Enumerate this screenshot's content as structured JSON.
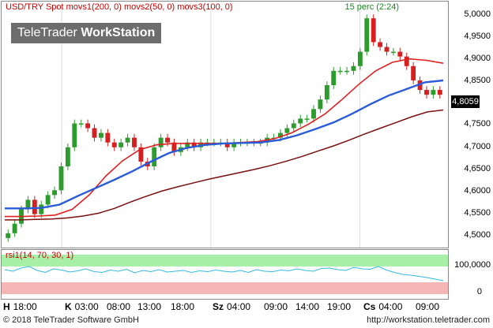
{
  "window": {
    "symbol": "USD/TRY Spot",
    "ma1": "movs1(200, 0)",
    "ma2": "movs2(50, 0)",
    "ma3": "movs3(100, 0)",
    "interval": "15 perc (2:24)",
    "logo_light": "TeleTrader ",
    "logo_bold": "WorkStation"
  },
  "colors": {
    "candle_up": "#2e9b2e",
    "candle_down": "#d42020",
    "ma1": "#7a1010",
    "ma2": "#e02020",
    "ma3": "#2a5bd8",
    "rsi_line": "#35b8e0",
    "rsi_high_band": "#a8f0a8",
    "rsi_low_band": "#f5b6b6"
  },
  "price_axis": {
    "ticks": [
      "5,0000",
      "4,9500",
      "4,9000",
      "4,8500",
      "4,8000",
      "4,7500",
      "4,7000",
      "4,6500",
      "4,6000",
      "4,5500",
      "4,5000"
    ],
    "last_price": "4,8059"
  },
  "rsi": {
    "label": "rsi1(14, 70, 30, 1)",
    "ticks": [
      "100,0000",
      "0"
    ]
  },
  "time_axis": [
    {
      "day": "H",
      "time": "18:00"
    },
    {
      "day": "K",
      "time": "03:00"
    },
    {
      "day": "",
      "time": "08:00"
    },
    {
      "day": "",
      "time": "13:00"
    },
    {
      "day": "",
      "time": "18:00"
    },
    {
      "day": "Sz",
      "time": "04:00"
    },
    {
      "day": "",
      "time": "09:00"
    },
    {
      "day": "",
      "time": "14:00"
    },
    {
      "day": "",
      "time": "19:00"
    },
    {
      "day": "Cs",
      "time": "04:00"
    },
    {
      "day": "",
      "time": "09:00"
    }
  ],
  "footer": {
    "copyright": "© 2018 TeleTrader Software GmbH",
    "url": "http://workstation.teletrader.com"
  },
  "chart_data": {
    "type": "candlestick",
    "y_range": [
      4.49,
      5.005
    ],
    "rsi_range": [
      0,
      100
    ],
    "rsi_levels": [
      70,
      30
    ],
    "close_series": [
      4.52,
      4.54,
      4.57,
      4.59,
      4.56,
      4.58,
      4.6,
      4.61,
      4.66,
      4.7,
      4.75,
      4.75,
      4.74,
      4.72,
      4.73,
      4.71,
      4.7,
      4.71,
      4.72,
      4.7,
      4.67,
      4.66,
      4.7,
      4.72,
      4.71,
      4.69,
      4.7,
      4.71,
      4.7,
      4.71,
      4.71,
      4.71,
      4.71,
      4.7,
      4.71,
      4.71,
      4.71,
      4.71,
      4.71,
      4.72,
      4.72,
      4.73,
      4.74,
      4.75,
      4.76,
      4.76,
      4.78,
      4.8,
      4.83,
      4.86,
      4.86,
      4.86,
      4.87,
      4.9,
      4.97,
      4.92,
      4.91,
      4.9,
      4.9,
      4.89,
      4.87,
      4.84,
      4.82,
      4.81,
      4.82,
      4.81
    ],
    "series": [
      {
        "name": "movs1(200, 0)",
        "values": [
          4.548,
          4.548,
          4.549,
          4.55,
          4.552,
          4.556,
          4.562,
          4.572,
          4.585,
          4.597,
          4.608,
          4.617,
          4.625,
          4.633,
          4.64,
          4.647,
          4.654,
          4.662,
          4.671,
          4.681,
          4.692,
          4.703,
          4.715,
          4.728,
          4.74,
          4.752,
          4.764,
          4.774,
          4.778
        ]
      },
      {
        "name": "movs2(50, 0)",
        "values": [
          4.555,
          4.555,
          4.556,
          4.558,
          4.57,
          4.6,
          4.64,
          4.672,
          4.695,
          4.705,
          4.708,
          4.708,
          4.708,
          4.708,
          4.71,
          4.712,
          4.718,
          4.73,
          4.748,
          4.77,
          4.8,
          4.832,
          4.86,
          4.878,
          4.885,
          4.882,
          4.876
        ]
      },
      {
        "name": "movs3(100, 0)",
        "values": [
          4.572,
          4.572,
          4.573,
          4.58,
          4.598,
          4.615,
          4.632,
          4.65,
          4.67,
          4.688,
          4.699,
          4.705,
          4.708,
          4.709,
          4.71,
          4.715,
          4.725,
          4.738,
          4.752,
          4.77,
          4.79,
          4.808,
          4.822,
          4.836,
          4.84
        ]
      }
    ],
    "rsi_values": [
      62,
      58,
      66,
      70,
      60,
      55,
      64,
      61,
      56,
      59,
      64,
      57,
      55,
      61,
      58,
      63,
      54,
      60,
      57,
      62,
      56,
      58,
      60,
      55,
      59,
      57,
      61,
      58,
      56,
      60,
      55,
      62,
      58,
      57,
      61,
      59,
      64,
      60,
      58,
      65,
      66,
      62,
      60,
      68,
      64,
      63,
      70,
      61,
      55,
      50,
      48,
      45,
      42,
      38,
      34
    ]
  }
}
